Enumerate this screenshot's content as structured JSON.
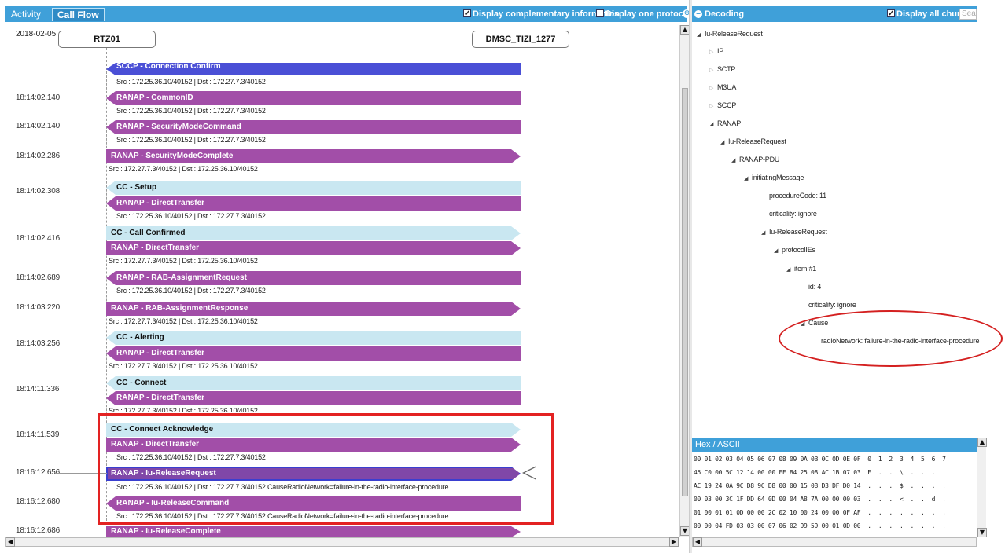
{
  "left_header": {
    "tabs": [
      "Activity",
      "Call Flow"
    ],
    "display_complementary": "Display complementary information",
    "display_one_protocol": "Display one protocol",
    "collapse_icon": "⊖"
  },
  "date": "2018-02-05",
  "nodes": {
    "left": "RTZ01",
    "right": "DMSC_TIZI_1277"
  },
  "timestamps": [
    "18:14:02.140",
    "18:14:02.140",
    "18:14:02.286",
    "18:14:02.308",
    "18:14:02.416",
    "18:14:02.689",
    "18:14:03.220",
    "18:14:03.256",
    "18:14:11.336",
    "18:14:11.539",
    "18:16:12.656",
    "18:16:12.680",
    "18:16:12.686"
  ],
  "messages": [
    {
      "label": "SCCP - Connection Confirm",
      "kind": "blue",
      "dir": "l"
    },
    {
      "label": "RANAP - CommonID",
      "kind": "purple",
      "dir": "l"
    },
    {
      "label": "RANAP - SecurityModeCommand",
      "kind": "purple",
      "dir": "l"
    },
    {
      "label": "RANAP - SecurityModeComplete",
      "kind": "purple",
      "dir": "r"
    },
    {
      "label": "CC - Setup",
      "kind": "light",
      "dir": "l"
    },
    {
      "label": "RANAP - DirectTransfer",
      "kind": "purple",
      "dir": "l"
    },
    {
      "label": "CC - Call Confirmed",
      "kind": "light",
      "dir": "r"
    },
    {
      "label": "RANAP - DirectTransfer",
      "kind": "purple",
      "dir": "r"
    },
    {
      "label": "RANAP - RAB-AssignmentRequest",
      "kind": "purple",
      "dir": "l"
    },
    {
      "label": "RANAP - RAB-AssignmentResponse",
      "kind": "purple",
      "dir": "r"
    },
    {
      "label": "CC - Alerting",
      "kind": "light",
      "dir": "l"
    },
    {
      "label": "RANAP - DirectTransfer",
      "kind": "purple",
      "dir": "l"
    },
    {
      "label": "CC - Connect",
      "kind": "light",
      "dir": "l"
    },
    {
      "label": "RANAP - DirectTransfer",
      "kind": "purple",
      "dir": "l"
    },
    {
      "label": "CC - Connect Acknowledge",
      "kind": "light",
      "dir": "r"
    },
    {
      "label": "RANAP - DirectTransfer",
      "kind": "purple",
      "dir": "r"
    },
    {
      "label": "RANAP - Iu-ReleaseRequest",
      "kind": "sel",
      "dir": "r"
    },
    {
      "label": "RANAP - Iu-ReleaseCommand",
      "kind": "purple",
      "dir": "l"
    },
    {
      "label": "RANAP - Iu-ReleaseComplete",
      "kind": "purple",
      "dir": "r"
    }
  ],
  "src_lines": [
    "Src : 172.25.36.10/40152 | Dst : 172.27.7.3/40152",
    "Src : 172.25.36.10/40152 | Dst : 172.27.7.3/40152",
    "Src : 172.25.36.10/40152 | Dst : 172.27.7.3/40152",
    "Src : 172.27.7.3/40152 | Dst : 172.25.36.10/40152",
    "Src : 172.25.36.10/40152 | Dst : 172.27.7.3/40152",
    "Src : 172.27.7.3/40152 | Dst : 172.25.36.10/40152",
    "Src : 172.25.36.10/40152 | Dst : 172.27.7.3/40152",
    "Src : 172.27.7.3/40152 | Dst : 172.25.36.10/40152",
    "Src : 172.27.7.3/40152 | Dst : 172.25.36.10/40152",
    "Src : 172.27.7.3/40152 | Dst : 172.25.36.10/40152",
    "Src : 172.25.36.10/40152 | Dst : 172.27.7.3/40152",
    "Src : 172.25.36.10/40152 | Dst : 172.27.7.3/40152 CauseRadioNetwork=failure-in-the-radio-interface-procedure",
    "Src : 172.25.36.10/40152 | Dst : 172.27.7.3/40152 CauseRadioNetwork=failure-in-the-radio-interface-procedure"
  ],
  "decoding": {
    "title": "Decoding",
    "display_all_chunks": "Display all chunks",
    "search_placeholder": "Sear",
    "tree": [
      "Iu-ReleaseRequest",
      "IP",
      "SCTP",
      "M3UA",
      "SCCP",
      "RANAP",
      "Iu-ReleaseRequest",
      "RANAP-PDU",
      "initiatingMessage",
      "procedureCode: 11",
      "criticality: ignore",
      "Iu-ReleaseRequest",
      "protocolIEs",
      "item #1",
      "id: 4",
      "criticality: ignore",
      "Cause",
      "radioNetwork: failure-in-the-radio-interface-procedure"
    ]
  },
  "hex": {
    "title": "Hex / ASCII",
    "rows": [
      "00 01 02 03 04 05 06 07 08 09 0A 0B 0C 0D 0E 0F  0  1  2  3  4  5  6  7",
      "45 C0 00 5C 12 14 00 00 FF 84 25 08 AC 1B 07 03  E  .  .  \\  .  .  .  .",
      "AC 19 24 0A 9C D8 9C D8 00 00 15 08 D3 DF D0 14  .  .  .  $  .  .  .  .",
      "00 03 00 3C 1F DD 64 0D 00 04 A8 7A 00 00 00 03  .  .  .  <  .  .  d  .",
      "01 00 01 01 0D 00 00 2C 02 10 00 24 00 00 0F AF  .  .  .  .  .  .  .  ,",
      "00 00 04 FD 03 03 00 07 06 02 99 59 00 01 0D 00  .  .  .  .  .  .  .  ."
    ]
  },
  "colors": {
    "header_blue": "#3fa0d9",
    "purple": "#a24ea8",
    "light_blue": "#c9e7f1",
    "annotation_red": "#e32222"
  }
}
